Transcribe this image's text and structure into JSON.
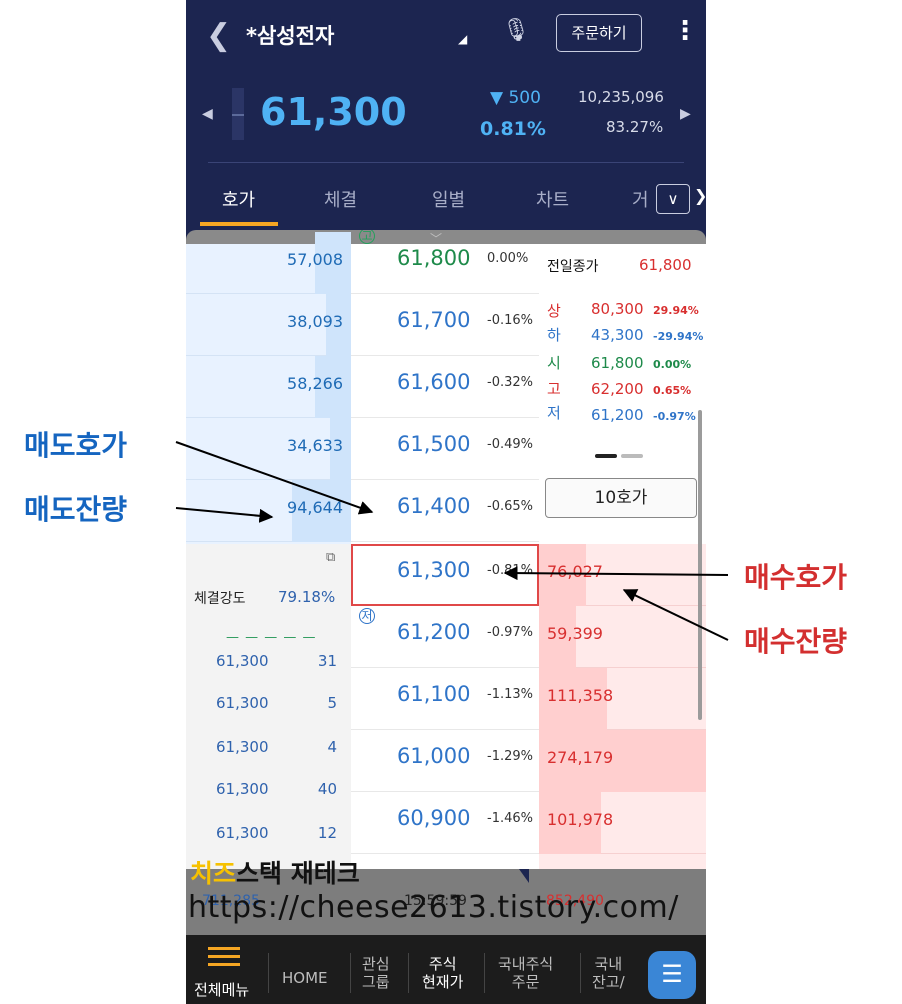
{
  "header": {
    "stock_name": "*삼성전자",
    "order_button": "주문하기",
    "price": "61,300",
    "change": "▼ 500",
    "change_pct": "0.81%",
    "volume": "10,235,096",
    "volume_ratio": "83.27%"
  },
  "tabs": [
    {
      "label": "호가",
      "active": true
    },
    {
      "label": "체결",
      "active": false
    },
    {
      "label": "일별",
      "active": false
    },
    {
      "label": "차트",
      "active": false
    },
    {
      "label": "거",
      "active": false
    }
  ],
  "asks": [
    {
      "qty": "57,008",
      "price": "61,800",
      "pct": "0.00%",
      "fill": 0.22
    },
    {
      "qty": "38,093",
      "price": "61,700",
      "pct": "-0.16%",
      "fill": 0.15
    },
    {
      "qty": "58,266",
      "price": "61,600",
      "pct": "-0.32%",
      "fill": 0.22
    },
    {
      "qty": "34,633",
      "price": "61,500",
      "pct": "-0.49%",
      "fill": 0.13
    },
    {
      "qty": "94,644",
      "price": "61,400",
      "pct": "-0.65%",
      "fill": 0.36
    }
  ],
  "bids": [
    {
      "qty": "76,027",
      "price": "61,300",
      "pct": "-0.81%",
      "fill": 0.28
    },
    {
      "qty": "59,399",
      "price": "61,200",
      "pct": "-0.97%",
      "fill": 0.22
    },
    {
      "qty": "111,358",
      "price": "61,100",
      "pct": "-1.13%",
      "fill": 0.41
    },
    {
      "qty": "274,179",
      "price": "61,000",
      "pct": "-1.29%",
      "fill": 1.0
    },
    {
      "qty": "101,978",
      "price": "60,900",
      "pct": "-1.46%",
      "fill": 0.37
    }
  ],
  "info": {
    "prev_close_label": "전일종가",
    "prev_close": "61,800",
    "upper_label": "상",
    "upper": "80,300",
    "upper_pct": "29.94%",
    "lower_label": "하",
    "lower": "43,300",
    "lower_pct": "-29.94%",
    "open_label": "시",
    "open": "61,800",
    "open_pct": "0.00%",
    "high_label": "고",
    "high": "62,200",
    "high_pct": "0.65%",
    "low_label": "저",
    "low": "61,200",
    "low_pct": "-0.97%",
    "ten_hoga": "10호가"
  },
  "trades": {
    "strength_label": "체결강도",
    "strength": "79.18%",
    "ticks": [
      {
        "price": "61,300",
        "qty": "31"
      },
      {
        "price": "61,300",
        "qty": "5"
      },
      {
        "price": "61,300",
        "qty": "4"
      },
      {
        "price": "61,300",
        "qty": "40"
      },
      {
        "price": "61,300",
        "qty": "12"
      }
    ]
  },
  "markers": {
    "high_mark": "고",
    "low_mark": "저"
  },
  "footer": {
    "total_ask": "711,285",
    "time": "15:59:59",
    "total_bid": "852,490"
  },
  "nav": {
    "menu": "전체메뉴",
    "home": "HOME",
    "watch_1": "관심",
    "watch_2": "그룹",
    "stock_1": "주식",
    "stock_2": "현재가",
    "domestic_1": "국내주식",
    "domestic_2": "주문",
    "balance_1": "국내",
    "balance_2": "잔고/"
  },
  "watermark": {
    "brand_yellow": "치즈",
    "brand_rest": "스택 재테크",
    "url": "https://cheese2613.tistory.com/"
  },
  "annotations": {
    "ask_price": "매도호가",
    "ask_qty": "매도잔량",
    "bid_price": "매수호가",
    "bid_qty": "매수잔량"
  },
  "colors": {
    "navy": "#1c2550",
    "ask_blue": "#1f6bb5",
    "bid_red": "#d82f2f",
    "accent_orange": "#f5a623"
  }
}
